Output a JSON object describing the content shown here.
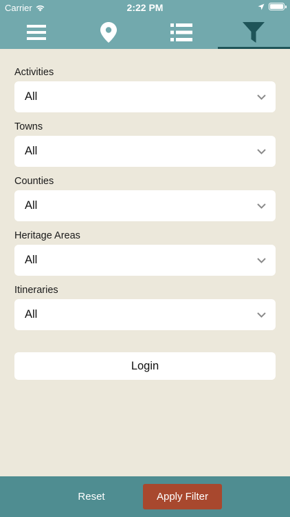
{
  "status_bar": {
    "carrier": "Carrier",
    "time": "2:22 PM",
    "icons": [
      "wifi-icon",
      "location-arrow-icon",
      "battery-icon"
    ]
  },
  "tab_bar": {
    "tabs": [
      {
        "icon": "menu-icon",
        "active": false
      },
      {
        "icon": "map-pin-icon",
        "active": false
      },
      {
        "icon": "list-icon",
        "active": false
      },
      {
        "icon": "filter-icon",
        "active": true
      }
    ]
  },
  "filters": [
    {
      "label": "Activities",
      "value": "All"
    },
    {
      "label": "Towns",
      "value": "All"
    },
    {
      "label": "Counties",
      "value": "All"
    },
    {
      "label": "Heritage Areas",
      "value": "All"
    },
    {
      "label": "Itineraries",
      "value": "All"
    }
  ],
  "login_label": "Login",
  "bottom_bar": {
    "reset_label": "Reset",
    "apply_label": "Apply Filter"
  },
  "colors": {
    "header": "#72a9ad",
    "active_indicator": "#1e5458",
    "background": "#ece8db",
    "bottom_bar": "#4f8d91",
    "apply_button": "#a8482e"
  }
}
